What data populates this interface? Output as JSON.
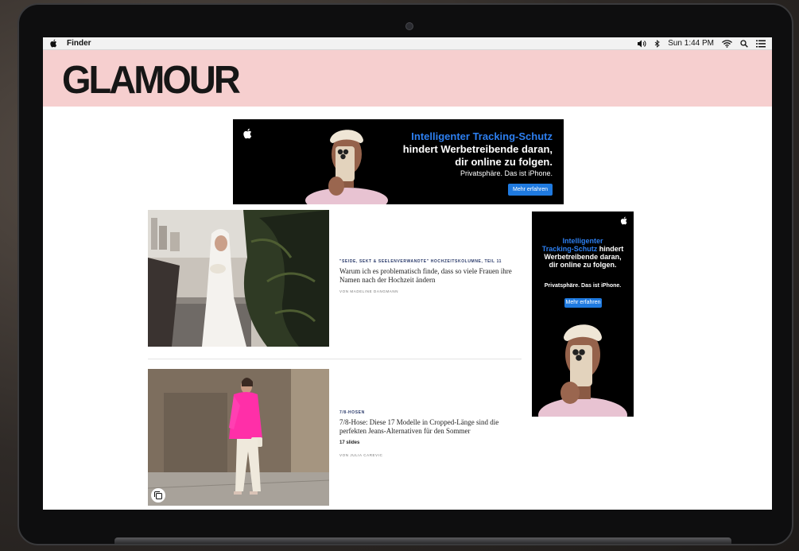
{
  "menubar": {
    "app_name": "Finder",
    "clock": "Sun 1:44 PM",
    "icons": [
      "apple-icon",
      "volume-icon",
      "bluetooth-icon",
      "wifi-icon",
      "search-icon",
      "control-center-icon"
    ]
  },
  "site": {
    "logo": "GLAMOUR",
    "header_color": "#f6cfcf"
  },
  "ad_top": {
    "line1": "Intelligenter Tracking-Schutz",
    "line2": "hindert Werbetreibende daran,",
    "line3": "dir online zu folgen.",
    "line4": "Privatsphäre. Das ist iPhone.",
    "button": "Mehr erfahren"
  },
  "ad_side": {
    "line1": "Intelligenter",
    "line2_blue": "Tracking-Schutz",
    "line2_white": " hindert",
    "line3": "Werbetreibende daran,",
    "line4": "dir online zu folgen.",
    "line5": "Privatsphäre. Das ist iPhone.",
    "button": "Mehr erfahren"
  },
  "articles": [
    {
      "kicker": "\"SEIDE, SEKT & SEELENVERWANDTE\" HOCHZEITSKOLUMNE, TEIL 11",
      "headline": "Warum ich es problematisch finde, dass so viele Frauen ihre Namen nach der Hochzeit ändern",
      "byline": "VON MADELINE DANGMANN"
    },
    {
      "kicker": "7/8-HOSEN",
      "headline": "7/8-Hose: Diese 17 Modelle in Cropped-Länge sind die perfekten Jeans-Alternativen für den Sommer",
      "slides": "17 slides",
      "byline": "VON JULIA CAREVIC"
    }
  ],
  "colors": {
    "ad_blue": "#2d7ff0",
    "kicker": "#2a3a6a"
  }
}
